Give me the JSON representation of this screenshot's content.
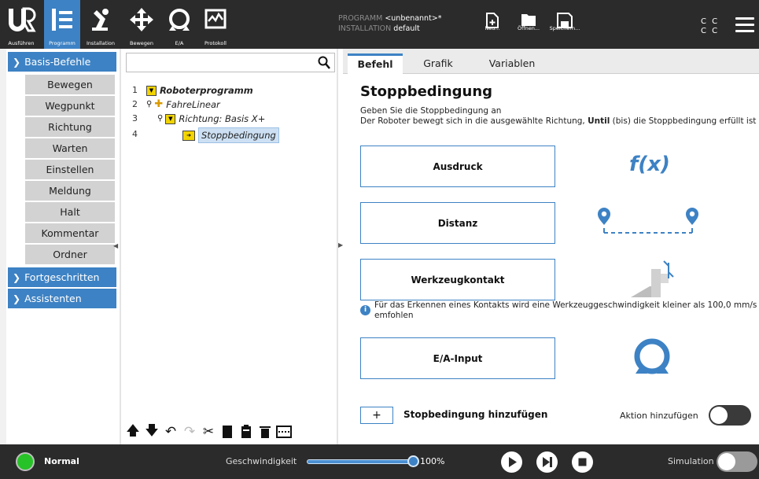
{
  "topbar": {
    "nav": [
      {
        "label": "Ausführen",
        "icon": "ur-logo-icon"
      },
      {
        "label": "Programm",
        "icon": "program-icon",
        "active": true
      },
      {
        "label": "Installation",
        "icon": "robot-arm-icon"
      },
      {
        "label": "Bewegen",
        "icon": "move-arrows-icon"
      },
      {
        "label": "E/A",
        "icon": "io-icon"
      },
      {
        "label": "Protokoll",
        "icon": "log-icon"
      }
    ],
    "program_key": "PROGRAMM",
    "program_value": "<unbenannt>*",
    "installation_key": "INSTALLATION",
    "installation_value": "default",
    "file": {
      "new_label": "Neu...",
      "open_label": "Öffnen...",
      "save_label": "Speichern..."
    },
    "cc_line1": "C C",
    "cc_line2": "C C"
  },
  "sidebar": {
    "basis": "Basis-Befehle",
    "commands": [
      "Bewegen",
      "Wegpunkt",
      "Richtung",
      "Warten",
      "Einstellen",
      "Meldung",
      "Halt",
      "Kommentar",
      "Ordner"
    ],
    "advanced": "Fortgeschritten",
    "assistants": "Assistenten"
  },
  "tree": {
    "search_placeholder": "",
    "rows": [
      {
        "num": "1",
        "text": "Roboterprogramm"
      },
      {
        "num": "2",
        "text": "FahreLinear"
      },
      {
        "num": "3",
        "text": "Richtung: Basis X+"
      },
      {
        "num": "4",
        "text": "Stoppbedingung"
      }
    ]
  },
  "tabs": [
    "Befehl",
    "Grafik",
    "Variablen"
  ],
  "panel": {
    "title": "Stoppbedingung",
    "desc_line1": "Geben Sie die Stoppbedingung an",
    "desc_line2a": "Der Roboter bewegt sich in die ausgewählte Richtung, ",
    "desc_line2b": "Until",
    "desc_line2c": " (bis) die Stoppbedingung erfüllt ist",
    "options": [
      "Ausdruck",
      "Distanz",
      "Werkzeugkontakt",
      "E/A-Input"
    ],
    "fx_label": "f(x)",
    "info": "Für das Erkennen eines Kontakts wird eine Werkzeuggeschwindigkeit kleiner als 100,0 mm/s emfohlen",
    "add_symbol": "+",
    "add_label": "Stopbedingung hinzufügen",
    "action_label": "Aktion hinzufügen"
  },
  "bottombar": {
    "status": "Normal",
    "speed_label": "Geschwindigkeit",
    "speed_value": "100%",
    "speed_fraction": 1.0,
    "simulation_label": "Simulation"
  },
  "colors": {
    "accent": "#3d82c4",
    "topbar_bg": "#2b2b2b",
    "status_green": "#27c227",
    "tree_marker": "#f2d400"
  }
}
